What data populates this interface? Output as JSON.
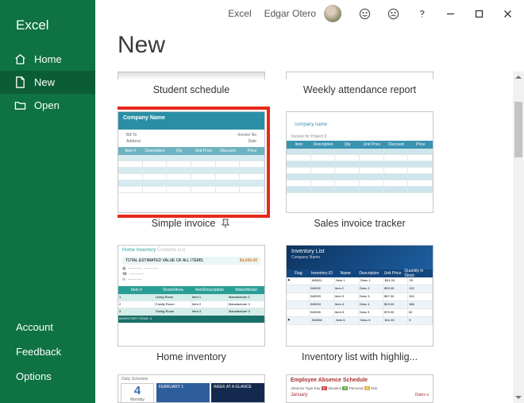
{
  "sidebar": {
    "title": "Excel",
    "nav": [
      {
        "label": "Home",
        "icon": "home"
      },
      {
        "label": "New",
        "icon": "new",
        "active": true
      },
      {
        "label": "Open",
        "icon": "open"
      }
    ],
    "bottom": [
      {
        "label": "Account"
      },
      {
        "label": "Feedback"
      },
      {
        "label": "Options"
      }
    ]
  },
  "titlebar": {
    "app": "Excel",
    "user": "Edgar Otero"
  },
  "page": {
    "title": "New"
  },
  "templates": {
    "peek_top": [
      {
        "label": "Student schedule"
      },
      {
        "label": "Weekly attendance report"
      }
    ],
    "row1": [
      {
        "label": "Simple invoice",
        "highlight": true,
        "pin": true,
        "thumb_title": "Company Name"
      },
      {
        "label": "Sales invoice tracker",
        "thumb_title": "company name"
      }
    ],
    "row2": [
      {
        "label": "Home inventory",
        "thumb_title": "Home Inventory",
        "thumb_sub": "Contents List",
        "thumb_total_label": "TOTAL ESTIMATED VALUE OF ALL ITEMS:",
        "thumb_total_value": "$4,040.00"
      },
      {
        "label": "Inventory list with highlig...",
        "thumb_title": "Inventory List",
        "thumb_sub": "Company Name"
      }
    ],
    "row3": [
      {
        "label": "",
        "thumb_title": "Daily Schedule",
        "thumb_day": "4",
        "thumb_dow": "Monday",
        "thumb_month": "FEBRUARY 1",
        "thumb_hint": "WEEK AT A GLANCE"
      },
      {
        "label": "",
        "thumb_title": "Employee Absence Schedule",
        "thumb_legend_v": "Vacation",
        "thumb_legend_p": "Personal",
        "thumb_legend_s": "Sick",
        "thumb_month": "January",
        "thumb_dates": "Dates o"
      }
    ]
  }
}
